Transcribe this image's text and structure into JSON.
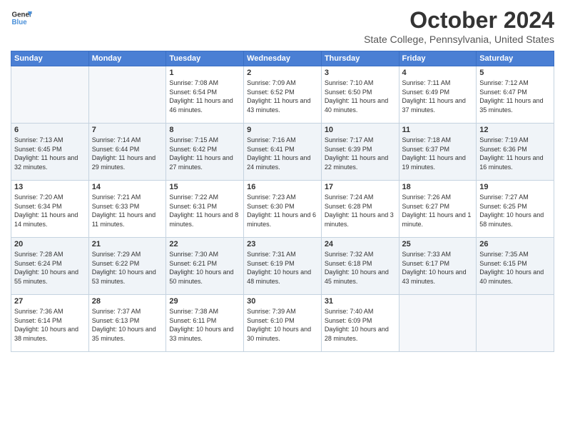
{
  "logo": {
    "line1": "General",
    "line2": "Blue"
  },
  "title": "October 2024",
  "location": "State College, Pennsylvania, United States",
  "days_of_week": [
    "Sunday",
    "Monday",
    "Tuesday",
    "Wednesday",
    "Thursday",
    "Friday",
    "Saturday"
  ],
  "weeks": [
    [
      {
        "num": "",
        "empty": true
      },
      {
        "num": "",
        "empty": true
      },
      {
        "num": "1",
        "sunrise": "7:08 AM",
        "sunset": "6:54 PM",
        "daylight": "11 hours and 46 minutes."
      },
      {
        "num": "2",
        "sunrise": "7:09 AM",
        "sunset": "6:52 PM",
        "daylight": "11 hours and 43 minutes."
      },
      {
        "num": "3",
        "sunrise": "7:10 AM",
        "sunset": "6:50 PM",
        "daylight": "11 hours and 40 minutes."
      },
      {
        "num": "4",
        "sunrise": "7:11 AM",
        "sunset": "6:49 PM",
        "daylight": "11 hours and 37 minutes."
      },
      {
        "num": "5",
        "sunrise": "7:12 AM",
        "sunset": "6:47 PM",
        "daylight": "11 hours and 35 minutes."
      }
    ],
    [
      {
        "num": "6",
        "sunrise": "7:13 AM",
        "sunset": "6:45 PM",
        "daylight": "11 hours and 32 minutes."
      },
      {
        "num": "7",
        "sunrise": "7:14 AM",
        "sunset": "6:44 PM",
        "daylight": "11 hours and 29 minutes."
      },
      {
        "num": "8",
        "sunrise": "7:15 AM",
        "sunset": "6:42 PM",
        "daylight": "11 hours and 27 minutes."
      },
      {
        "num": "9",
        "sunrise": "7:16 AM",
        "sunset": "6:41 PM",
        "daylight": "11 hours and 24 minutes."
      },
      {
        "num": "10",
        "sunrise": "7:17 AM",
        "sunset": "6:39 PM",
        "daylight": "11 hours and 22 minutes."
      },
      {
        "num": "11",
        "sunrise": "7:18 AM",
        "sunset": "6:37 PM",
        "daylight": "11 hours and 19 minutes."
      },
      {
        "num": "12",
        "sunrise": "7:19 AM",
        "sunset": "6:36 PM",
        "daylight": "11 hours and 16 minutes."
      }
    ],
    [
      {
        "num": "13",
        "sunrise": "7:20 AM",
        "sunset": "6:34 PM",
        "daylight": "11 hours and 14 minutes."
      },
      {
        "num": "14",
        "sunrise": "7:21 AM",
        "sunset": "6:33 PM",
        "daylight": "11 hours and 11 minutes."
      },
      {
        "num": "15",
        "sunrise": "7:22 AM",
        "sunset": "6:31 PM",
        "daylight": "11 hours and 8 minutes."
      },
      {
        "num": "16",
        "sunrise": "7:23 AM",
        "sunset": "6:30 PM",
        "daylight": "11 hours and 6 minutes."
      },
      {
        "num": "17",
        "sunrise": "7:24 AM",
        "sunset": "6:28 PM",
        "daylight": "11 hours and 3 minutes."
      },
      {
        "num": "18",
        "sunrise": "7:26 AM",
        "sunset": "6:27 PM",
        "daylight": "11 hours and 1 minute."
      },
      {
        "num": "19",
        "sunrise": "7:27 AM",
        "sunset": "6:25 PM",
        "daylight": "10 hours and 58 minutes."
      }
    ],
    [
      {
        "num": "20",
        "sunrise": "7:28 AM",
        "sunset": "6:24 PM",
        "daylight": "10 hours and 55 minutes."
      },
      {
        "num": "21",
        "sunrise": "7:29 AM",
        "sunset": "6:22 PM",
        "daylight": "10 hours and 53 minutes."
      },
      {
        "num": "22",
        "sunrise": "7:30 AM",
        "sunset": "6:21 PM",
        "daylight": "10 hours and 50 minutes."
      },
      {
        "num": "23",
        "sunrise": "7:31 AM",
        "sunset": "6:19 PM",
        "daylight": "10 hours and 48 minutes."
      },
      {
        "num": "24",
        "sunrise": "7:32 AM",
        "sunset": "6:18 PM",
        "daylight": "10 hours and 45 minutes."
      },
      {
        "num": "25",
        "sunrise": "7:33 AM",
        "sunset": "6:17 PM",
        "daylight": "10 hours and 43 minutes."
      },
      {
        "num": "26",
        "sunrise": "7:35 AM",
        "sunset": "6:15 PM",
        "daylight": "10 hours and 40 minutes."
      }
    ],
    [
      {
        "num": "27",
        "sunrise": "7:36 AM",
        "sunset": "6:14 PM",
        "daylight": "10 hours and 38 minutes."
      },
      {
        "num": "28",
        "sunrise": "7:37 AM",
        "sunset": "6:13 PM",
        "daylight": "10 hours and 35 minutes."
      },
      {
        "num": "29",
        "sunrise": "7:38 AM",
        "sunset": "6:11 PM",
        "daylight": "10 hours and 33 minutes."
      },
      {
        "num": "30",
        "sunrise": "7:39 AM",
        "sunset": "6:10 PM",
        "daylight": "10 hours and 30 minutes."
      },
      {
        "num": "31",
        "sunrise": "7:40 AM",
        "sunset": "6:09 PM",
        "daylight": "10 hours and 28 minutes."
      },
      {
        "num": "",
        "empty": true
      },
      {
        "num": "",
        "empty": true
      }
    ]
  ]
}
